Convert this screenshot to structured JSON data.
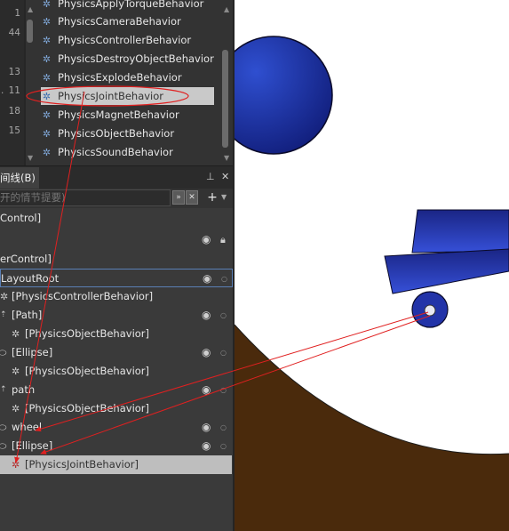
{
  "asset_list": {
    "line_numbers": [
      "1",
      "44",
      "13",
      "11",
      "18",
      "15"
    ],
    "items": [
      {
        "label": "PhysicsApplyTorqueBehavior"
      },
      {
        "label": "PhysicsCameraBehavior"
      },
      {
        "label": "PhysicsControllerBehavior"
      },
      {
        "label": "PhysicsDestroyObjectBehavior"
      },
      {
        "label": "PhysicsExplodeBehavior"
      },
      {
        "label": "PhysicsJointBehavior",
        "selected": true
      },
      {
        "label": "PhysicsMagnetBehavior"
      },
      {
        "label": "PhysicsObjectBehavior"
      },
      {
        "label": "PhysicsSoundBehavior"
      }
    ],
    "icon": "gear-icon"
  },
  "objects_panel": {
    "tab_label": "间线(B)",
    "pin_icon": "pin-icon",
    "close_icon": "close-icon",
    "search_placeholder": "开的情节提要)",
    "add_icon": "plus-icon"
  },
  "tree": {
    "rows": [
      {
        "label": "Control]"
      },
      {
        "label": ""
      },
      {
        "label": "erControl]"
      },
      {
        "label": "LayoutRoot"
      },
      {
        "label": "[PhysicsControllerBehavior]"
      },
      {
        "label": "[Path]"
      },
      {
        "label": "[PhysicsObjectBehavior]"
      },
      {
        "label": "[Ellipse]"
      },
      {
        "label": "[PhysicsObjectBehavior]"
      },
      {
        "label": "path"
      },
      {
        "label": "[PhysicsObjectBehavior]"
      },
      {
        "label": "wheel"
      },
      {
        "label": "[Ellipse]"
      },
      {
        "label": "[PhysicsJointBehavior]"
      }
    ]
  },
  "colors": {
    "panel_bg": "#3a3a3a",
    "selection": "#c9c9c9",
    "annotation_red": "#e02020",
    "ground_brown": "#4a2a0c",
    "shape_blue": "#1c2b9a"
  }
}
